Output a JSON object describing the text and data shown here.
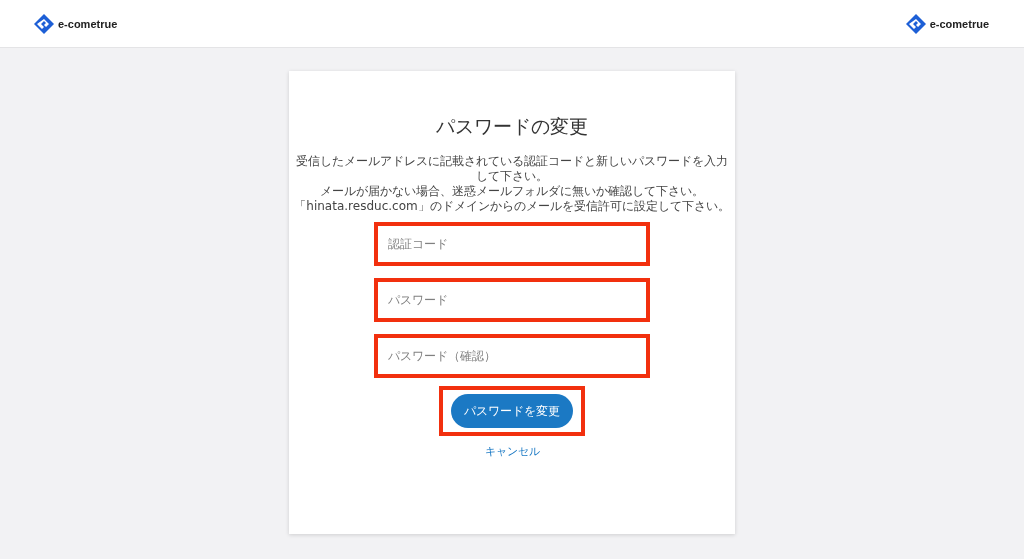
{
  "header": {
    "logo_left": "e-cometrue",
    "logo_right": "e-cometrue"
  },
  "card": {
    "title": "パスワードの変更",
    "description": [
      "受信したメールアドレスに記載されている認証コードと新しいパスワードを入力して下さい。",
      "メールが届かない場合、迷惑メールフォルダに無いか確認して下さい。",
      "「hinata.resduc.com」のドメインからのメールを受信許可に設定して下さい。"
    ],
    "fields": [
      {
        "placeholder": "認証コード"
      },
      {
        "placeholder": "パスワード"
      },
      {
        "placeholder": "パスワード（確認）"
      }
    ],
    "submit": "パスワードを変更",
    "cancel": "キャンセル"
  }
}
